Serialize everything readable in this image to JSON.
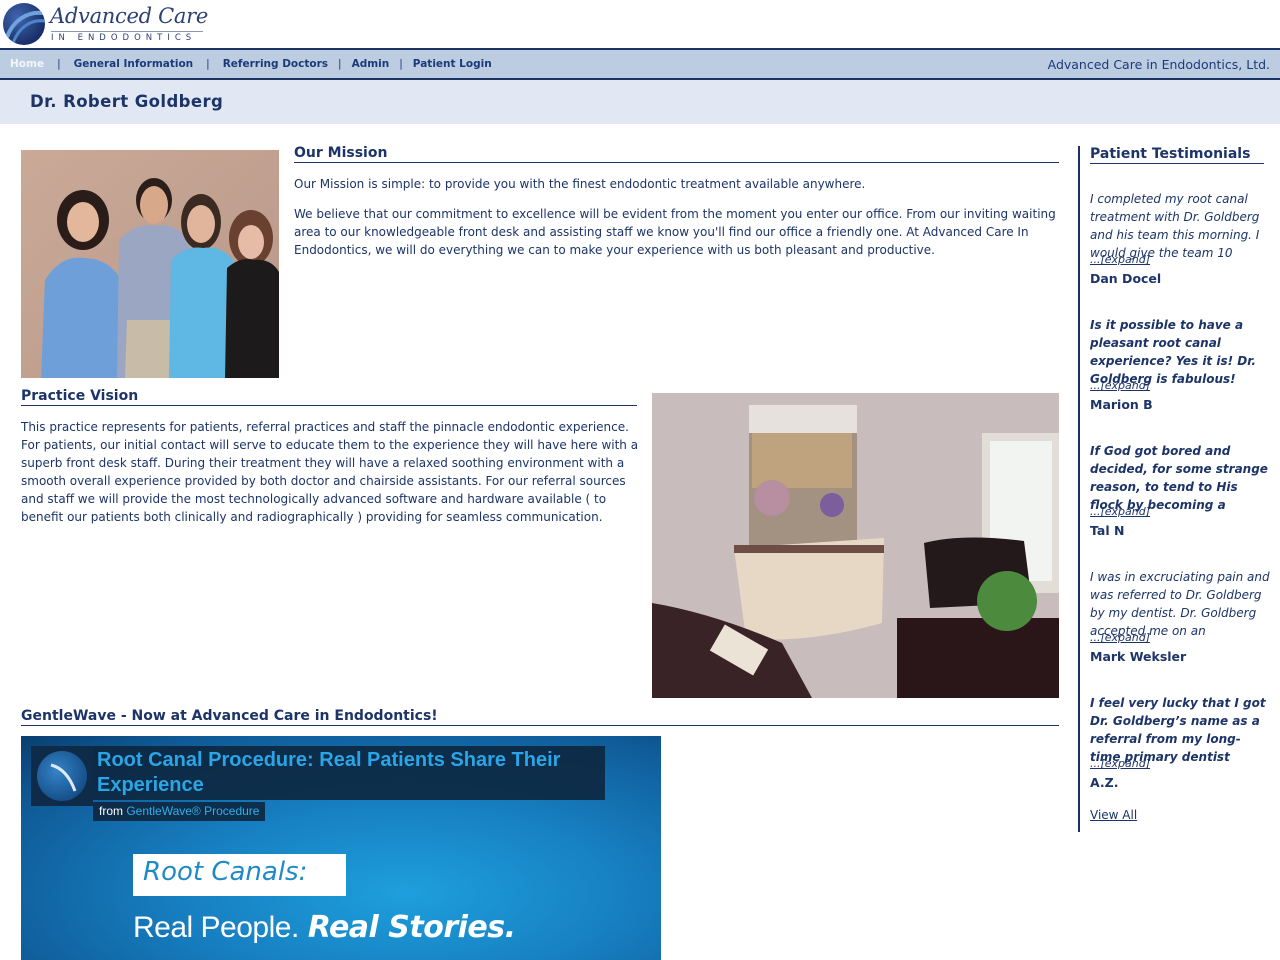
{
  "header": {
    "logo_title": "Advanced Care",
    "logo_subtitle": "IN ENDODONTICS"
  },
  "nav": {
    "items": [
      {
        "label": "Home",
        "active": true
      },
      {
        "label": "General Information",
        "active": false
      },
      {
        "label": "Referring Doctors",
        "active": false
      },
      {
        "label": "Admin",
        "active": false
      },
      {
        "label": "Patient Login",
        "active": false
      }
    ],
    "right_text": "Advanced Care in Endodontics, Ltd."
  },
  "page": {
    "title": "Dr. Robert Goldberg"
  },
  "mission": {
    "heading": "Our Mission",
    "paragraphs": [
      "Our Mission is simple: to provide you with the finest endodontic treatment available anywhere.",
      "We believe that our commitment to excellence will be evident from the moment you enter our office. From our inviting waiting area to our knowledgeable front desk and assisting staff we know you'll find our office a friendly one. At Advanced Care In Endodontics, we will do everything we can to make your experience with us both pleasant and productive."
    ],
    "image_alt": "Dr. Goldberg with his team"
  },
  "vision": {
    "heading": "Practice Vision",
    "paragraph": "This practice represents for patients, referral practices and staff the pinnacle endodontic experience. For patients, our initial contact will serve to educate them to the experience they will have here with a superb front desk staff.  During their treatment they will have a relaxed soothing environment with a smooth overall experience provided by both doctor and chairside assistants.  For our referral sources and staff we will provide the most technologically advanced software and hardware available ( to benefit our patients both clinically and radiographically ) providing for seamless communication.",
    "image_alt": "Office waiting room"
  },
  "gentlewave": {
    "heading": "GentleWave - Now at Advanced Care in Endodontics!",
    "video": {
      "title": "Root Canal Procedure: Real Patients Share Their Experience",
      "from_label": "from",
      "from_source": "GentleWave® Procedure",
      "box_text": "Root Canals:",
      "tagline_light": "Real People.",
      "tagline_bold": "Real Stories."
    }
  },
  "testimonials": {
    "heading": "Patient Testimonials",
    "expand_label": "...[expand]",
    "items": [
      {
        "quote": "I completed my root canal treatment with Dr. Goldberg and his team this morning. I would give the team 10",
        "author": "Dan Docel",
        "bold": false
      },
      {
        "quote": "Is it possible to have a pleasant root canal experience? Yes it is!  Dr. Goldberg is fabulous!",
        "author": "Marion B",
        "bold": true
      },
      {
        "quote": "If God got bored and decided, for some strange reason, to tend to His flock by becoming a",
        "author": "Tal N",
        "bold": true
      },
      {
        "quote": "I was in excruciating pain and was referred to Dr. Goldberg by my dentist. Dr. Goldberg accepted me on an",
        "author": "Mark Weksler",
        "bold": false
      },
      {
        "quote": "I feel very lucky that I got Dr. Goldberg’s name as a referral from my long-time primary dentist",
        "author": "A.Z.",
        "bold": true
      }
    ],
    "view_all_label": "View All"
  }
}
